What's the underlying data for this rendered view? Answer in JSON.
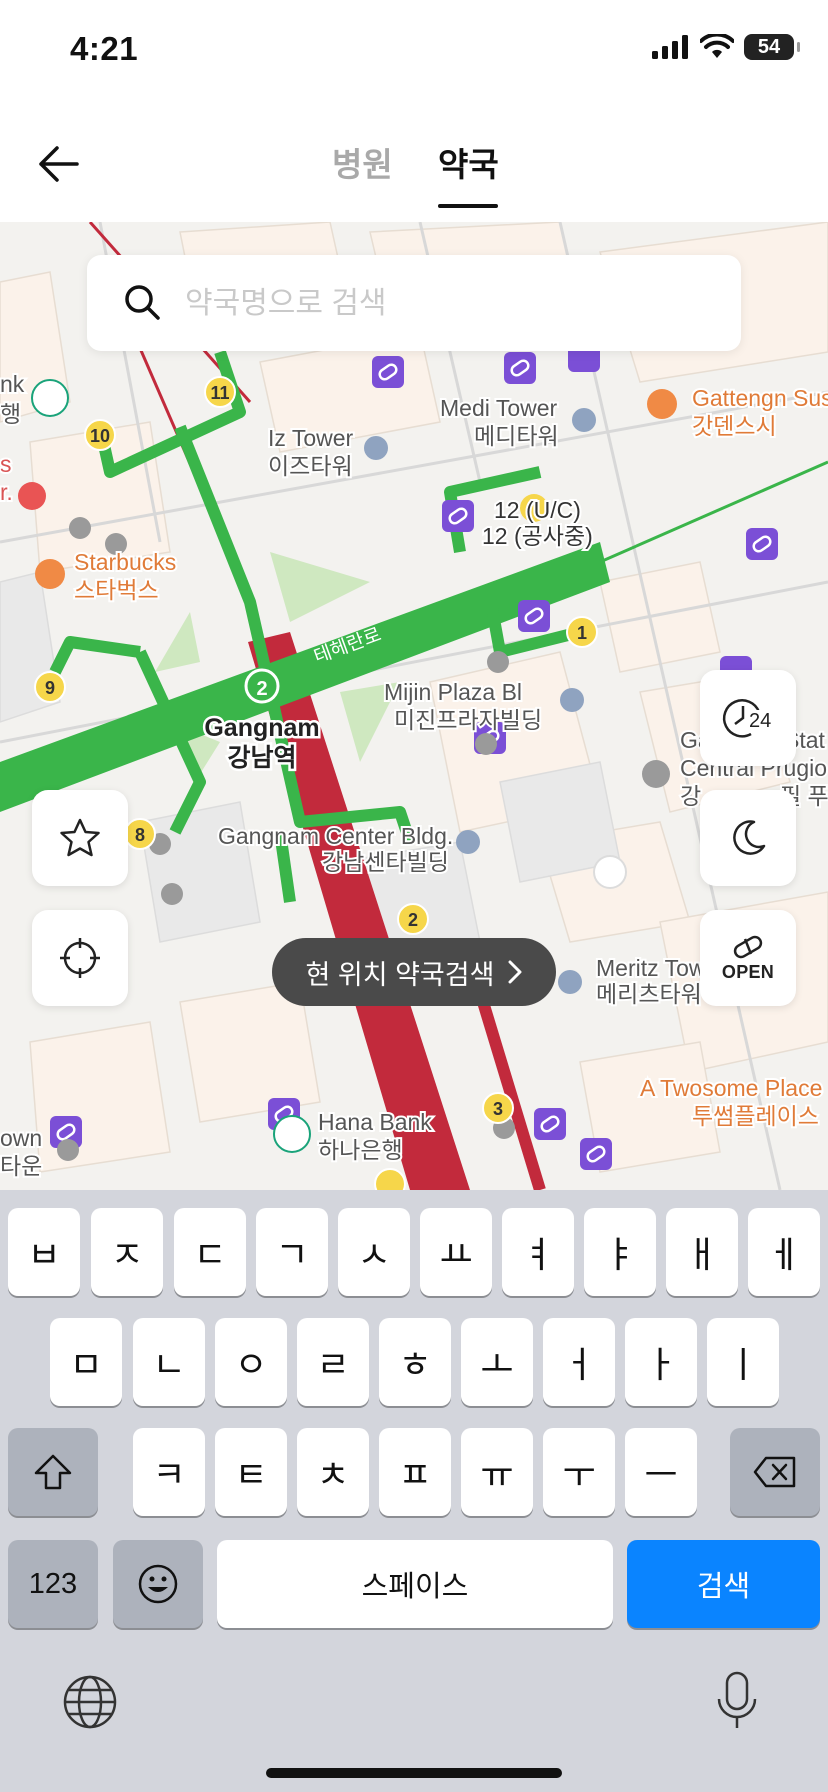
{
  "status_bar": {
    "time": "4:21",
    "battery": "54"
  },
  "header": {
    "tabs": [
      {
        "label": "병원",
        "active": false
      },
      {
        "label": "약국",
        "active": true
      }
    ]
  },
  "search": {
    "placeholder": "약국명으로 검색",
    "value": ""
  },
  "map": {
    "labels": {
      "bank_partial": "nk",
      "bank_partial_kr": "행",
      "iz_tower_en": "Iz Tower",
      "iz_tower_kr": "이즈타워",
      "medi_tower_en": "Medi Tower",
      "medi_tower_kr": "메디타워",
      "gattengn_en": "Gattengn Sus",
      "gattengn_kr": "갓덴스시",
      "exit_12_uc": "12 (U/C)",
      "exit_12_kr": "12 (공사중)",
      "starbucks_en": "Starbucks",
      "starbucks_kr": "스타벅스",
      "teheran_ro": "테헤란로",
      "mijin_en": "Mijin Plaza Bl",
      "mijin_kr": "미진프라자빌딩",
      "gangnam_en": "Gangnam",
      "gangnam_kr": "강남역",
      "gangnam_center_en": "Gangnam Center Bldg.",
      "gangnam_center_kr": "강남센타빌딩",
      "central_en_1": "Ga",
      "central_en_1b": "Stat",
      "central_en_2": "Central Prugio",
      "central_kr": "강",
      "central_kr_b": "필 푸",
      "meritz_en": "Meritz Tow",
      "meritz_kr": "메리츠타워",
      "twosome_en": "A Twosome Place",
      "twosome_kr": "투썸플레이스",
      "hana_en": "Hana Bank",
      "hana_kr": "하나은행",
      "own_partial": "own",
      "town_kr_partial": "타운",
      "s_partial": "s",
      "r_partial": "r.",
      "line2": "2"
    },
    "exits": [
      "11",
      "10",
      "9",
      "8",
      "1",
      "2",
      "3",
      "12"
    ]
  },
  "controls": {
    "hours24_label": "24",
    "open_label": "OPEN",
    "current_location_search": "현 위치 약국검색"
  },
  "keyboard": {
    "row1": [
      "ㅂ",
      "ㅈ",
      "ㄷ",
      "ㄱ",
      "ㅅ",
      "ㅛ",
      "ㅕ",
      "ㅑ",
      "ㅐ",
      "ㅔ"
    ],
    "row2": [
      "ㅁ",
      "ㄴ",
      "ㅇ",
      "ㄹ",
      "ㅎ",
      "ㅗ",
      "ㅓ",
      "ㅏ",
      "ㅣ"
    ],
    "row3": [
      "ㅋ",
      "ㅌ",
      "ㅊ",
      "ㅍ",
      "ㅠ",
      "ㅜ",
      "ㅡ"
    ],
    "numbers_label": "123",
    "space_label": "스페이스",
    "search_label": "검색"
  },
  "colors": {
    "subway_green": "#3ab54a",
    "subway_red": "#c22a3c",
    "pharmacy_purple": "#7b4fd6",
    "exit_yellow": "#f6d64a",
    "keyboard_blue": "#0a84ff"
  }
}
